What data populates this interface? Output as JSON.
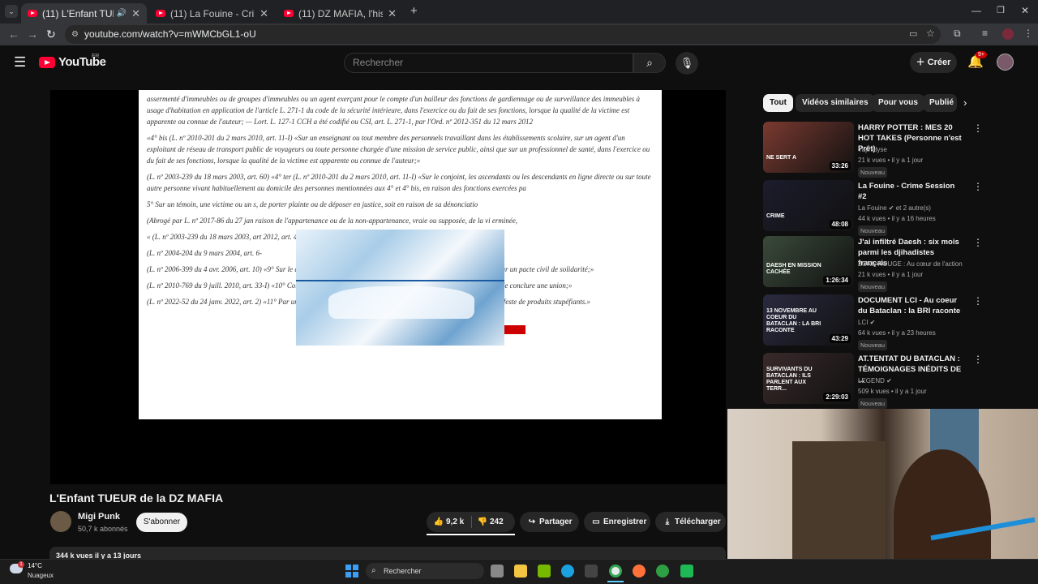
{
  "browser": {
    "tabs": [
      {
        "title": "(11) L'Enfant TUEUR de la D",
        "active": true
      },
      {
        "title": "(11) La Fouine - Crime Session",
        "active": false
      },
      {
        "title": "(11) DZ MAFIA, l'histoire compl",
        "active": false
      }
    ],
    "url": "youtube.com/watch?v=mWMCbGL1-oU"
  },
  "youtube": {
    "logo_text": "YouTube",
    "region": "FR",
    "search_placeholder": "Rechercher",
    "create_label": "Créer",
    "notif_count": "9+"
  },
  "video": {
    "title": "L'Enfant TUEUR de la DZ MAFIA",
    "channel": "Migi Punk",
    "subscribers": "50,7 k abonnés",
    "subscribe_label": "S'abonner",
    "likes": "9,2 k",
    "dislikes": "242",
    "share_label": "Partager",
    "save_label": "Enregistrer",
    "download_label": "Télécharger",
    "stats": "344 k vues  il y a 13 jours"
  },
  "document_text": [
    "assermenté d'immeubles ou de groupes d'immeubles ou un agent exerçant pour le compte d'un bailleur des fonctions de gardiennage ou de surveillance des immeubles à usage d'habitation en application de l'article L. 271-1 du code de la sécurité intérieure, dans l'exercice ou du fait de ses fonctions, lorsque la qualité de la victime est apparente ou connue de l'auteur; — Lort. L. 127-1 CCH a été codifié ou CSI, art. L. 271-1, par l'Ord. nº 2012-351 du 12 mars 2012",
    "«4° bis (L. nº 2010-201 du 2 mars 2010, art. 11-I) «Sur un enseignant ou tout membre des personnels travaillant dans les établissements scolaire, sur un agent d'un exploitant de réseau de transport public de voyageurs ou toute personne chargée d'une mission de service public, ainsi que sur un professionnel de santé, dans l'exercice ou du fait de ses fonctions, lorsque la qualité de la victime est apparente ou connue de l'auteur;»",
    "(L. nº 2003-239 du 18 mars 2003, art. 60) «4° ter (L. nº 2010-201 du 2 mars 2010, art. 11-I) «Sur le conjoint, les ascendants ou les descendants en ligne directe ou sur toute autre personne vivant habituellement au domicile des personnes mentionnées aux 4° et 4° bis, en raison des fonctions exercées pa",
    "5° Sur un témoin, une victime ou un                                                      s, de porter plainte ou de déposer en justice, soit en raison de sa dénonciatio",
    "(Abrogé par L. nº 2017-86 du 27 jan                                                       raison de l'appartenance ou de la non-appartenance, vraie ou supposée, de la vi                                                   erminée,",
    "« (L. nº 2003-239 du 18 mars 2003, art                                                      2012, art. 4) «ou identité» sexuelle de la victime»;»",
    "(L. nº 2004-204 du 9 mars 2004, art. 6-",
    "(L. nº 2006-399 du 4 avr. 2006, art. 10) «9° Sur le conjoint ou le concubin de la victime ou le partenaire lié à la victime par un pacte civil de solidarité;»",
    "(L. nº 2010-769 du 9 juill. 2010, art. 33-I) «10° Contre une personne en raison de son refus de contracter un mariage ou de conclure une union;»",
    "(L. nº 2022-52 du 24 janv. 2022, art. 2) «11° Par une personne agissant en état d'ivresse manifeste ou sous l'emprise manifeste de produits stupéfiants.»"
  ],
  "chips": [
    "Tout",
    "Vidéos similaires",
    "Pour vous",
    "Publié"
  ],
  "recommendations": [
    {
      "title": "HARRY POTTER : MES 20 HOT TAKES (Personne n'est Prêt)",
      "channel": "Yajinalyse",
      "meta": "21 k vues • il y a 1 jour",
      "badge": "Nouveau",
      "duration": "33:26",
      "color": "#7a3a30"
    },
    {
      "title": "La Fouine - Crime Session #2",
      "channel": "La Fouine ✔ et 2 autre(s)",
      "meta": "44 k vues • il y a 16 heures",
      "badge": "Nouveau",
      "duration": "48:08",
      "color": "#1c1c2c"
    },
    {
      "title": "J'ai infiltré Daesh : six mois parmi les djihadistes français",
      "channel": "ZONE ROUGE : Au cœur de l'action",
      "meta": "21 k vues • il y a 1 jour",
      "badge": "Nouveau",
      "duration": "1:26:34",
      "color": "#3a4a3a"
    },
    {
      "title": "DOCUMENT LCI - Au coeur du Bataclan : la BRI raconte",
      "channel": "LCI ✔",
      "meta": "64 k vues • il y a 23 heures",
      "badge": "Nouveau",
      "duration": "43:29",
      "color": "#2a2a40"
    },
    {
      "title": "AT.TENTAT DU BATACLAN : TÉMOIGNAGES INÉDITS DE ...",
      "channel": "LEGEND ✔",
      "meta": "509 k vues • il y a 1 jour",
      "badge": "Nouveau",
      "duration": "2:29:03",
      "color": "#3a2a2a"
    }
  ],
  "thumb_captions": [
    "NE SERT A",
    "CRIME",
    "DAESH EN MISSION CACHÉE",
    "13 NOVEMBRE AU COEUR DU BATACLAN : LA BRI RACONTE",
    "SURVIVANTS DU BATACLAN : ILS PARLENT AUX TERR..."
  ],
  "taskbar": {
    "temperature": "14°C",
    "weather": "Nuageux",
    "search": "Rechercher"
  }
}
